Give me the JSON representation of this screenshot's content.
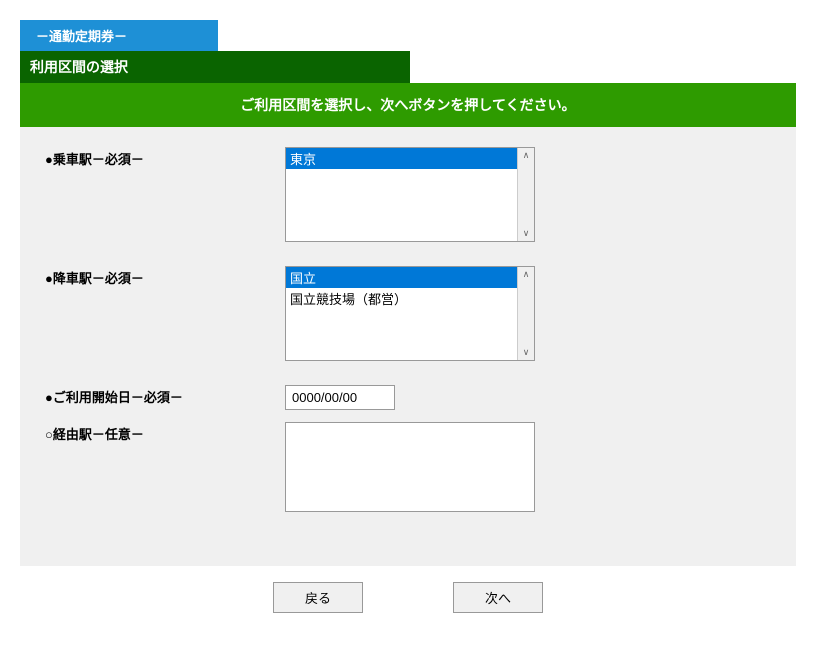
{
  "tab": {
    "label": "－通勤定期券－"
  },
  "subheader": {
    "label": "利用区間の選択"
  },
  "instruction": "ご利用区間を選択し、次へボタンを押してください。",
  "form": {
    "boarding": {
      "label": "●乗車駅－必須－",
      "options": [
        "東京"
      ],
      "selectedIndex": 0
    },
    "alighting": {
      "label": "●降車駅－必須－",
      "options": [
        "国立",
        "国立競技場（都営）"
      ],
      "selectedIndex": 0
    },
    "startDate": {
      "label": "●ご利用開始日－必須－",
      "value": "0000/00/00"
    },
    "via": {
      "label": "○経由駅－任意－",
      "value": ""
    }
  },
  "buttons": {
    "back": "戻る",
    "next": "次へ"
  },
  "scroll": {
    "up": "∧",
    "down": "∨"
  }
}
